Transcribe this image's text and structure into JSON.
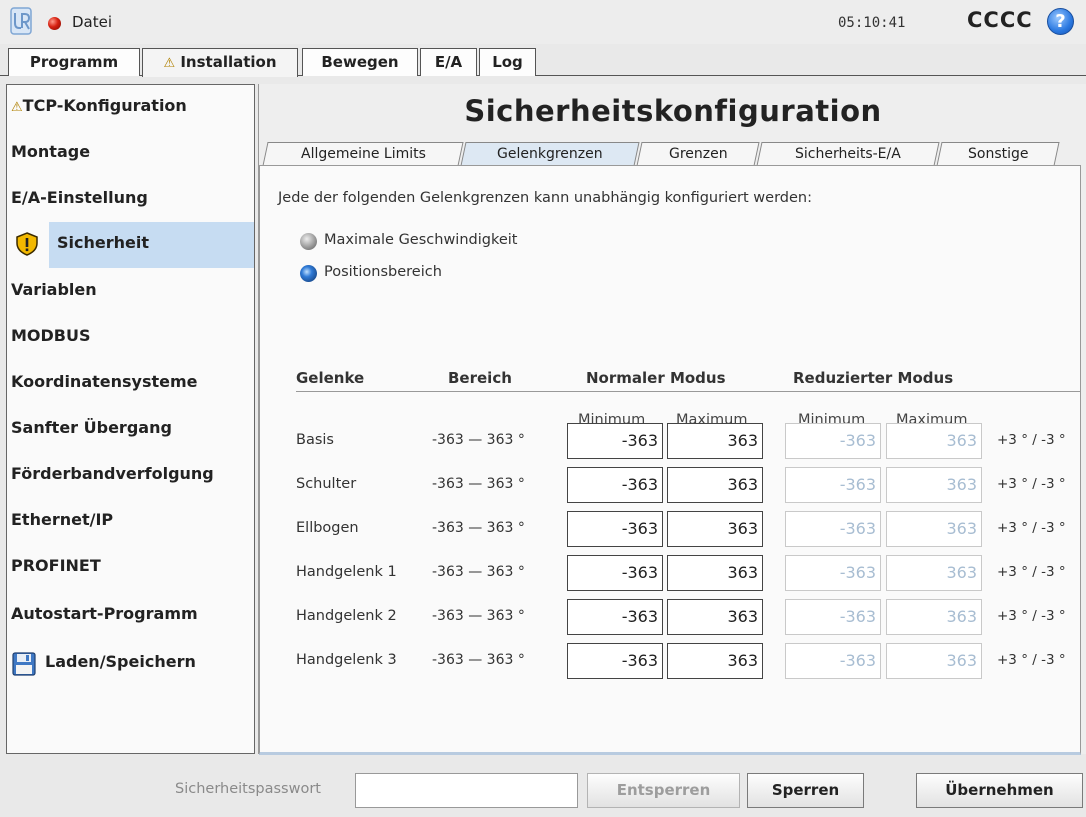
{
  "titlebar": {
    "file_menu": "Datei",
    "clock": "05:10:41",
    "robot_name": "CCCC",
    "help_label": "?"
  },
  "top_tabs": [
    {
      "label": "Programm"
    },
    {
      "label": "Installation",
      "warning": "⚠"
    },
    {
      "label": "Bewegen"
    },
    {
      "label": "E/A"
    },
    {
      "label": "Log"
    }
  ],
  "sidebar": {
    "items": [
      {
        "label": "TCP-Konfiguration",
        "warning": "⚠"
      },
      {
        "label": "Montage"
      },
      {
        "label": "E/A-Einstellung"
      },
      {
        "label": "Sicherheit",
        "icon": "shield-warning-icon",
        "selected": true
      },
      {
        "label": "Variablen"
      },
      {
        "label": "MODBUS"
      },
      {
        "label": "Koordinatensysteme"
      },
      {
        "label": "Sanfter Übergang"
      },
      {
        "label": "Förderbandverfolgung"
      },
      {
        "label": "Ethernet/IP"
      },
      {
        "label": "PROFINET"
      },
      {
        "label": "Autostart-Programm"
      },
      {
        "label": "Laden/Speichern",
        "icon": "floppy-disk-icon"
      }
    ]
  },
  "main": {
    "title": "Sicherheitskonfiguration",
    "sub_tabs": [
      {
        "label": "Allgemeine Limits"
      },
      {
        "label": "Gelenkgrenzen",
        "active": true
      },
      {
        "label": "Grenzen"
      },
      {
        "label": "Sicherheits-E/A"
      },
      {
        "label": "Sonstige"
      }
    ],
    "intro": "Jede der folgenden Gelenkgrenzen kann unabhängig konfiguriert werden:",
    "options": [
      {
        "label": "Maximale Geschwindigkeit",
        "selected": false
      },
      {
        "label": "Positionsbereich",
        "selected": true
      }
    ],
    "table": {
      "headers": {
        "joints": "Gelenke",
        "range": "Bereich",
        "normal": "Normaler Modus",
        "reduced": "Reduzierter Modus"
      },
      "sub_headers": {
        "min": "Minimum",
        "max": "Maximum"
      },
      "rows": [
        {
          "joint": "Basis",
          "range": "-363 — 363 °",
          "normal_min": "-363",
          "normal_max": "363",
          "reduced_min": "-363",
          "reduced_max": "363",
          "tolerance": "+3 ° / -3 °"
        },
        {
          "joint": "Schulter",
          "range": "-363 — 363 °",
          "normal_min": "-363",
          "normal_max": "363",
          "reduced_min": "-363",
          "reduced_max": "363",
          "tolerance": "+3 ° / -3 °"
        },
        {
          "joint": "Ellbogen",
          "range": "-363 — 363 °",
          "normal_min": "-363",
          "normal_max": "363",
          "reduced_min": "-363",
          "reduced_max": "363",
          "tolerance": "+3 ° / -3 °"
        },
        {
          "joint": "Handgelenk 1",
          "range": "-363 — 363 °",
          "normal_min": "-363",
          "normal_max": "363",
          "reduced_min": "-363",
          "reduced_max": "363",
          "tolerance": "+3 ° / -3 °"
        },
        {
          "joint": "Handgelenk 2",
          "range": "-363 — 363 °",
          "normal_min": "-363",
          "normal_max": "363",
          "reduced_min": "-363",
          "reduced_max": "363",
          "tolerance": "+3 ° / -3 °"
        },
        {
          "joint": "Handgelenk 3",
          "range": "-363 — 363 °",
          "normal_min": "-363",
          "normal_max": "363",
          "reduced_min": "-363",
          "reduced_max": "363",
          "tolerance": "+3 ° / -3 °"
        }
      ]
    }
  },
  "bottom": {
    "password_label": "Sicherheitspasswort",
    "password_value": "",
    "unlock": "Entsperren",
    "lock": "Sperren",
    "apply": "Übernehmen"
  },
  "colors": {
    "selection": "#c6dcf2",
    "active_subtab": "#dde8f3",
    "disabled_text": "#a8bdd2",
    "status_led": "#d62010"
  }
}
